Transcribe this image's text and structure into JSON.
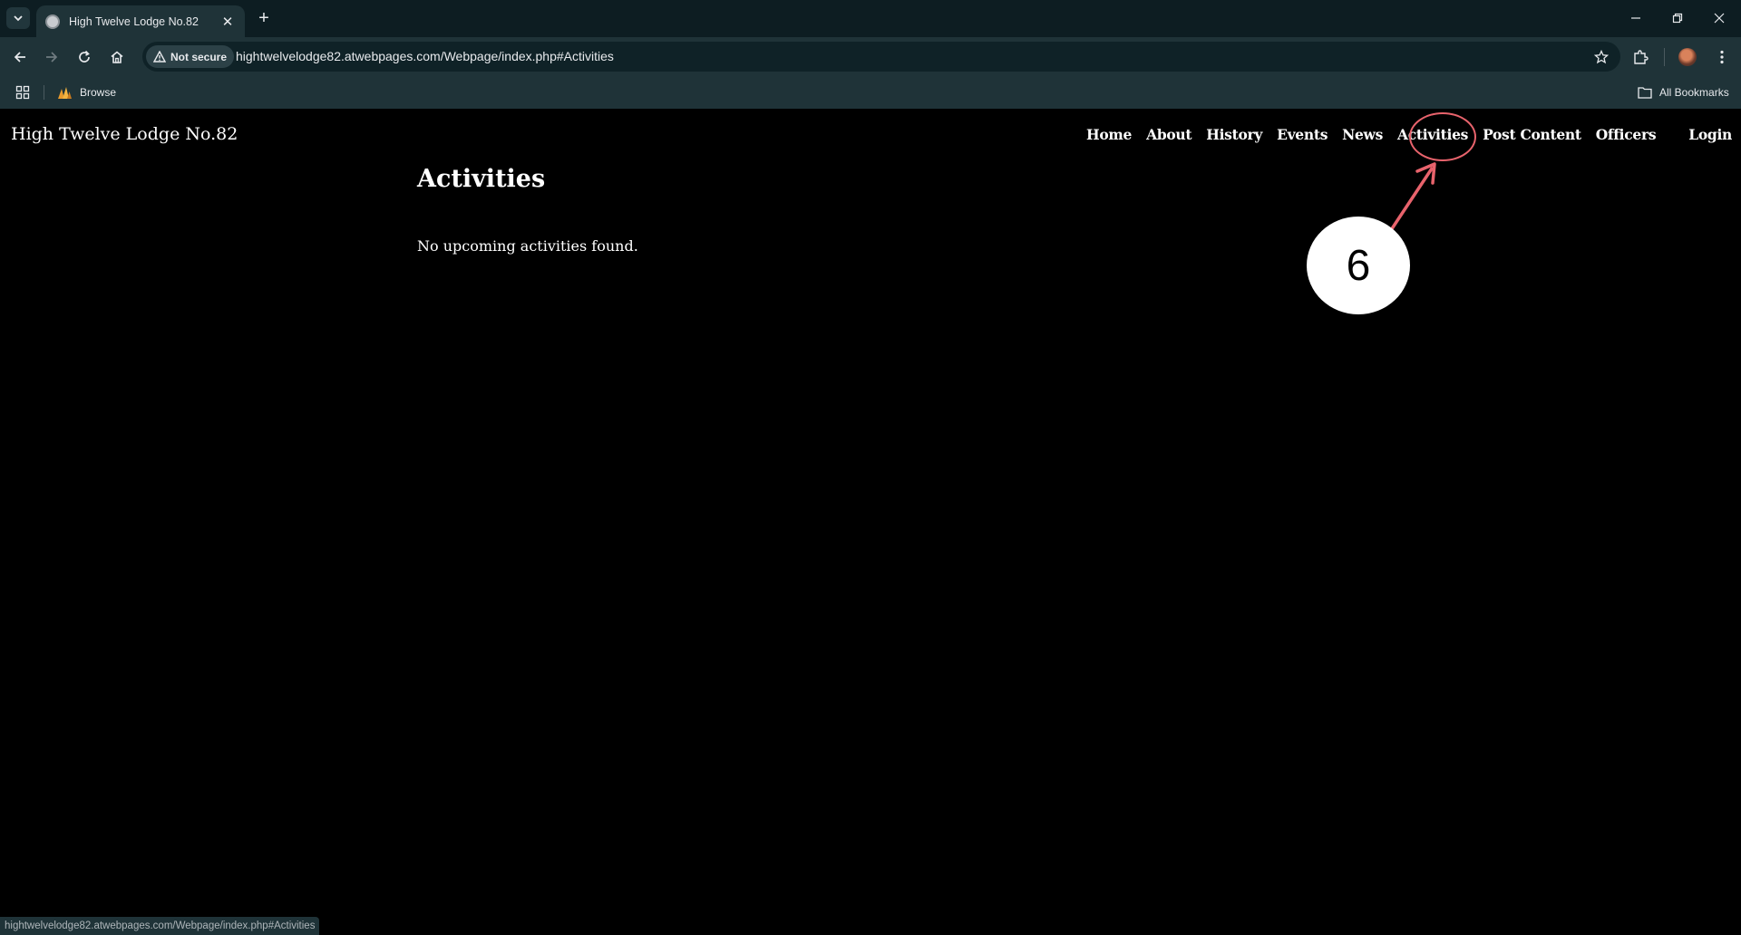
{
  "browser": {
    "tab": {
      "title": "High Twelve Lodge No.82",
      "favicon": "globe-favicon"
    },
    "address_bar": {
      "security_label": "Not secure",
      "url": "hightwelvelodge82.atwebpages.com/Webpage/index.php#Activities"
    },
    "bookmarks": {
      "browse_label": "Browse",
      "all_bookmarks_label": "All Bookmarks"
    },
    "status_url": "hightwelvelodge82.atwebpages.com/Webpage/index.php#Activities",
    "colors": {
      "chrome_dark": "#0d1d22",
      "chrome": "#1f3338",
      "omnibox": "#0f2227"
    }
  },
  "site": {
    "title": "High Twelve Lodge No.82",
    "nav": [
      "Home",
      "About",
      "History",
      "Events",
      "News",
      "Activities",
      "Post Content",
      "Officers"
    ],
    "login_label": "Login"
  },
  "main": {
    "heading": "Activities",
    "message": "No upcoming activities found."
  },
  "annotation": {
    "step_number": "6",
    "color": "#e8636c",
    "target": "Activities"
  }
}
